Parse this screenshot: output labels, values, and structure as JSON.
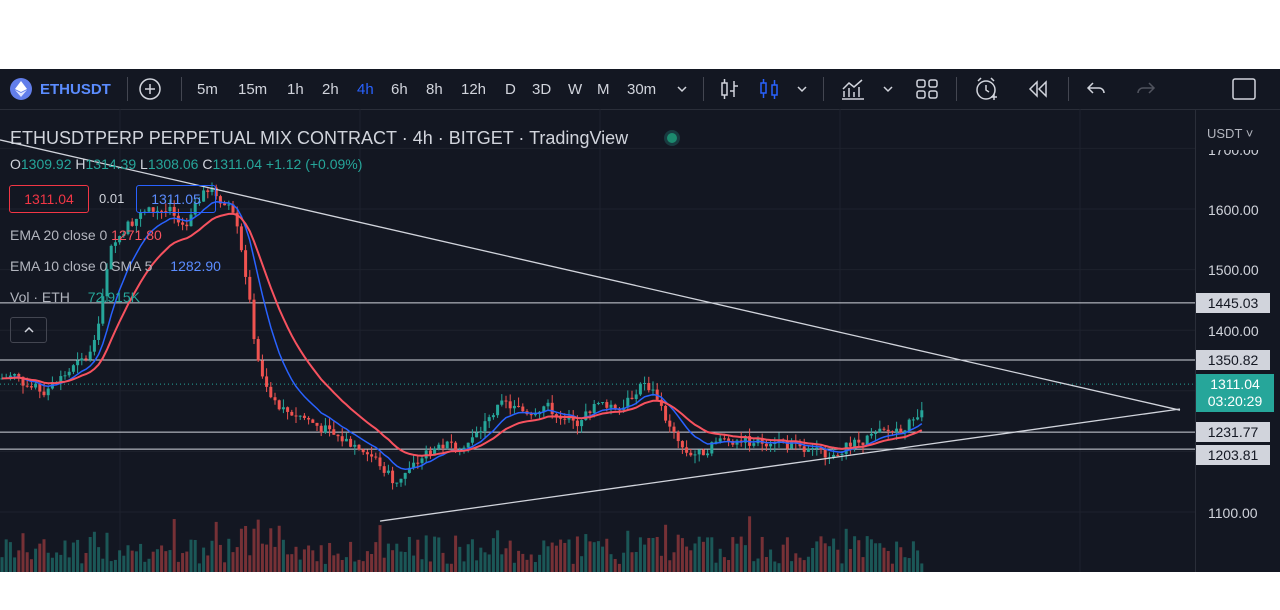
{
  "toolbar": {
    "symbol": "ETHUSDT",
    "intervals": [
      "5m",
      "15m",
      "1h",
      "2h",
      "4h",
      "6h",
      "8h",
      "12h",
      "D",
      "3D",
      "W",
      "M",
      "30m"
    ],
    "active_interval": "4h",
    "icons": [
      "plus-circle-icon",
      "bar-style-icon",
      "candle-style-icon",
      "indicators-icon",
      "templates-icon",
      "alert-icon",
      "replay-icon",
      "undo-icon",
      "redo-icon",
      "fullscreen-icon"
    ]
  },
  "legend": {
    "title": "ETHUSDTPERP PERPETUAL MIX CONTRACT · 4h · BITGET · TradingView",
    "ohlc": {
      "o_label": "O",
      "o": "1309.92",
      "h_label": "H",
      "h": "1314.39",
      "l_label": "L",
      "l": "1308.06",
      "c_label": "C",
      "c": "1311.04",
      "change": "+1.12 (+0.09%)"
    },
    "bid": "1311.04",
    "spread": "0.01",
    "ask": "1311.05",
    "ema20_label": "EMA 20 close 0",
    "ema20_value": "1271.80",
    "ema10_label": "EMA 10 close 0 SMA 5",
    "ema10_value": "1282.90",
    "vol_label": "Vol · ETH",
    "vol_value": "72.915K"
  },
  "price_scale": {
    "currency": "USDT",
    "ticks": [
      "1700.00",
      "1600.00",
      "1500.00",
      "1400.00",
      "1100.00"
    ],
    "levels": [
      "1445.03",
      "1350.82",
      "1231.77",
      "1203.81"
    ],
    "last_price": "1311.04",
    "countdown": "03:20:29"
  },
  "colors": {
    "background": "#131722",
    "up": "#26a69a",
    "down": "#ef5350",
    "ema20": "#f7525f",
    "ema10": "#2962ff",
    "accent": "#2962ff"
  },
  "chart_data": {
    "type": "candlestick",
    "ylim": [
      1080,
      1730
    ],
    "horizontal_levels": [
      1445.03,
      1350.82,
      1231.77,
      1203.81
    ],
    "last_price": 1311.04,
    "price_path": [
      [
        0,
        1320
      ],
      [
        15,
        1325
      ],
      [
        30,
        1305
      ],
      [
        45,
        1300
      ],
      [
        60,
        1320
      ],
      [
        75,
        1340
      ],
      [
        90,
        1360
      ],
      [
        100,
        1420
      ],
      [
        110,
        1530
      ],
      [
        125,
        1570
      ],
      [
        140,
        1590
      ],
      [
        155,
        1600
      ],
      [
        170,
        1595
      ],
      [
        185,
        1560
      ],
      [
        200,
        1620
      ],
      [
        215,
        1630
      ],
      [
        225,
        1605
      ],
      [
        235,
        1600
      ],
      [
        245,
        1500
      ],
      [
        255,
        1380
      ],
      [
        262,
        1320
      ],
      [
        270,
        1290
      ],
      [
        280,
        1270
      ],
      [
        290,
        1265
      ],
      [
        305,
        1255
      ],
      [
        320,
        1240
      ],
      [
        335,
        1225
      ],
      [
        350,
        1215
      ],
      [
        365,
        1200
      ],
      [
        380,
        1180
      ],
      [
        395,
        1150
      ],
      [
        410,
        1170
      ],
      [
        425,
        1195
      ],
      [
        440,
        1210
      ],
      [
        455,
        1210
      ],
      [
        470,
        1215
      ],
      [
        480,
        1235
      ],
      [
        495,
        1265
      ],
      [
        505,
        1280
      ],
      [
        515,
        1270
      ],
      [
        530,
        1265
      ],
      [
        545,
        1275
      ],
      [
        560,
        1260
      ],
      [
        575,
        1245
      ],
      [
        590,
        1270
      ],
      [
        605,
        1280
      ],
      [
        620,
        1270
      ],
      [
        635,
        1300
      ],
      [
        648,
        1310
      ],
      [
        660,
        1285
      ],
      [
        670,
        1235
      ],
      [
        685,
        1200
      ],
      [
        700,
        1195
      ],
      [
        715,
        1215
      ],
      [
        730,
        1220
      ],
      [
        745,
        1218
      ],
      [
        760,
        1215
      ],
      [
        775,
        1220
      ],
      [
        790,
        1210
      ],
      [
        805,
        1200
      ],
      [
        820,
        1198
      ],
      [
        835,
        1200
      ],
      [
        850,
        1210
      ],
      [
        865,
        1220
      ],
      [
        880,
        1230
      ],
      [
        895,
        1235
      ],
      [
        910,
        1245
      ],
      [
        925,
        1265
      ]
    ],
    "trendlines": [
      {
        "from": [
          0,
          1714
        ],
        "to": [
          1180,
          1268
        ]
      },
      {
        "from": [
          380,
          1085
        ],
        "to": [
          1180,
          1270
        ]
      }
    ]
  }
}
